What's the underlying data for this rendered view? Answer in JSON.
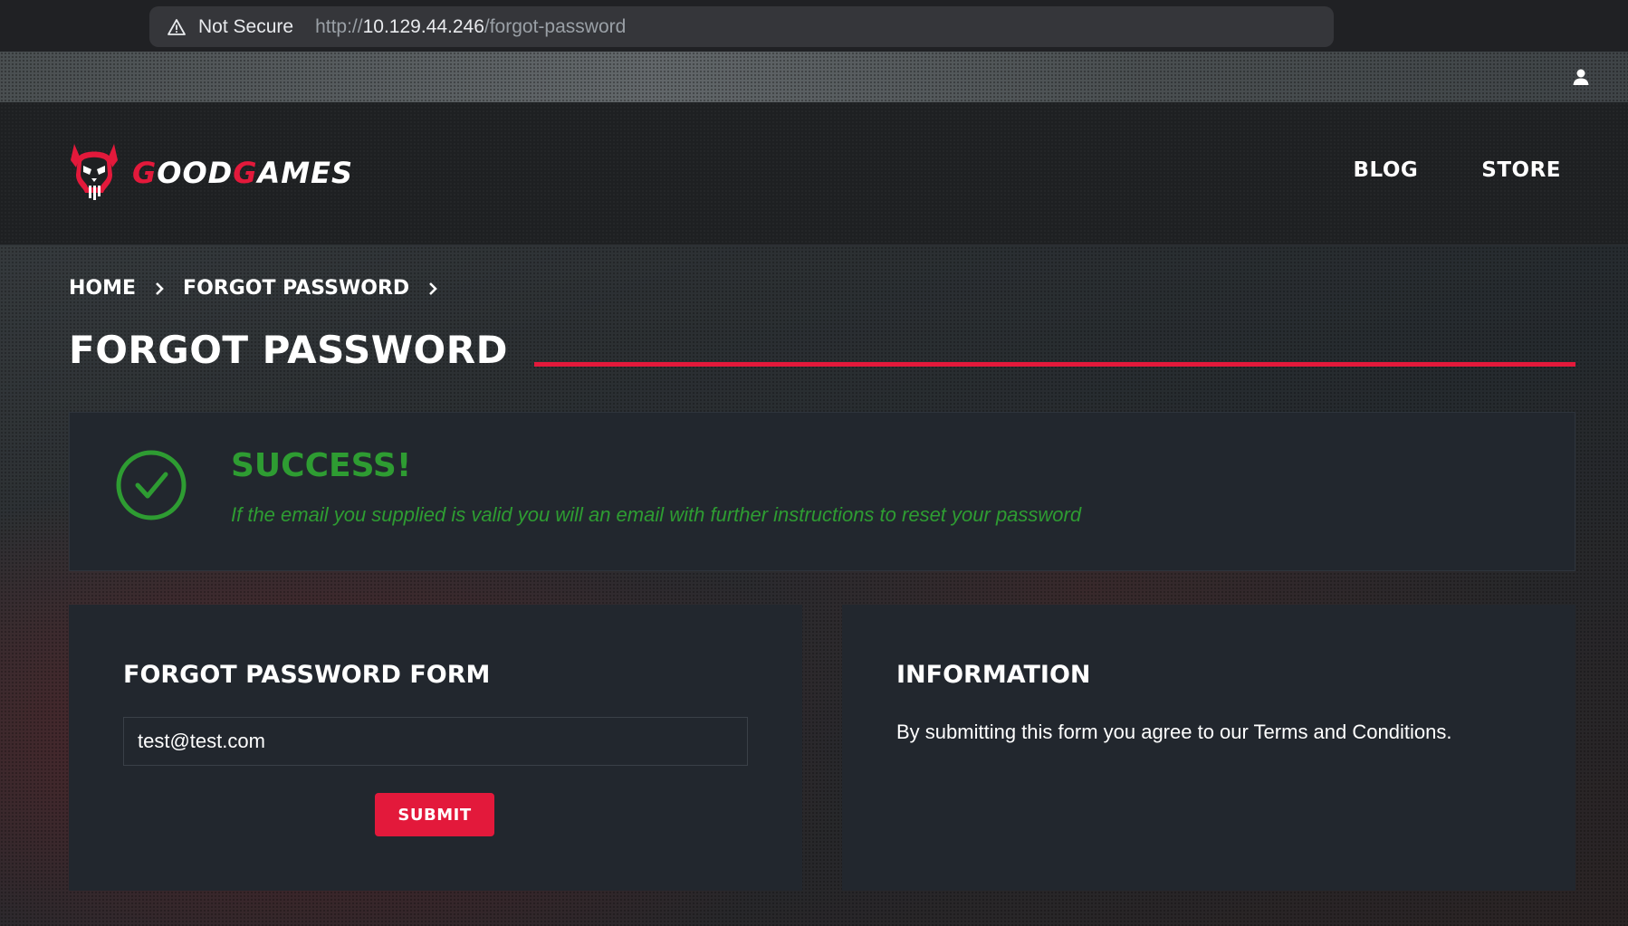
{
  "browser": {
    "security_label": "Not Secure",
    "url_prefix": "http://",
    "url_host": "10.129.44.246",
    "url_path": "/forgot-password"
  },
  "brand": {
    "name_part1_red": "G",
    "name_part1": "OOD",
    "name_part2_red": "G",
    "name_part2": "AMES",
    "accent_color": "#e3193b",
    "success_color": "#2e9c32"
  },
  "nav": {
    "items": [
      {
        "label": "BLOG"
      },
      {
        "label": "STORE"
      }
    ]
  },
  "breadcrumb": {
    "items": [
      {
        "label": "HOME"
      },
      {
        "label": "FORGOT PASSWORD"
      }
    ]
  },
  "page": {
    "title": "FORGOT PASSWORD"
  },
  "alert": {
    "heading": "SUCCESS!",
    "message": "If the email you supplied is valid you will an email with further instructions to reset your password"
  },
  "form": {
    "heading": "FORGOT PASSWORD FORM",
    "email_value": "test@test.com",
    "submit_label": "SUBMIT"
  },
  "info": {
    "heading": "INFORMATION",
    "text": "By submitting this form you agree to our Terms and Conditions."
  }
}
